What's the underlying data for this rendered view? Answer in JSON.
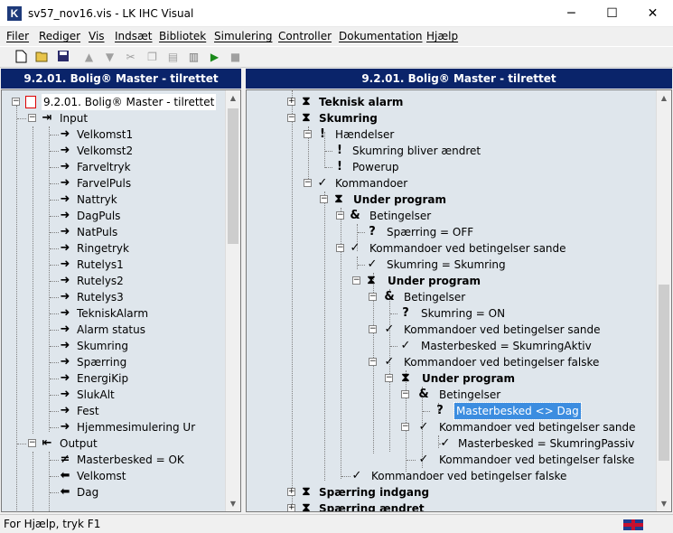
{
  "window": {
    "title": "sv57_nov16.vis - LK IHC Visual",
    "icon_letter": "K",
    "minimize": "─",
    "maximize": "☐",
    "close": "✕"
  },
  "menu": [
    "Filer",
    "Rediger",
    "Vis",
    "Indsæt",
    "Bibliotek",
    "Simulering",
    "Controller",
    "Dokumentation",
    "Hjælp"
  ],
  "toolbar": [
    "new-file-icon",
    "open-folder-icon",
    "save-icon",
    "upload-icon",
    "download-icon",
    "cut-icon",
    "copy-icon",
    "paste-icon",
    "run-icon",
    "stop-icon"
  ],
  "left_panel": {
    "title": "9.2.01. Bolig® Master - tilrettet",
    "root": "9.2.01. Bolig® Master - tilrettet",
    "input_label": "Input",
    "inputs": [
      "Velkomst1",
      "Velkomst2",
      "Farveltryk",
      "FarvelPuls",
      "Nattryk",
      "DagPuls",
      "NatPuls",
      "Ringetryk",
      "Rutelys1",
      "Rutelys2",
      "Rutelys3",
      "TekniskAlarm",
      "Alarm status",
      "Skumring",
      "Spærring",
      "EnergiKip",
      "SlukAlt",
      "Fest",
      "Hjemmesimulering Ur"
    ],
    "output_label": "Output",
    "outputs": [
      "Masterbesked = OK",
      "Velkomst",
      "Dag"
    ]
  },
  "right_panel": {
    "title": "9.2.01. Bolig® Master - tilrettet",
    "rows": [
      "Teknisk alarm",
      "Skumring",
      "Hændelser",
      "Skumring bliver ændret",
      "Powerup",
      "Kommandoer",
      "Under program",
      "Betingelser",
      "Spærring = OFF",
      "Kommandoer ved betingelser sande",
      "Skumring = Skumring",
      "Under program",
      "Betingelser",
      "Skumring = ON",
      "Kommandoer ved betingelser sande",
      "Masterbesked = SkumringAktiv",
      "Kommandoer ved betingelser falske",
      "Under program",
      "Betingelser",
      "Masterbesked <> Dag",
      "Kommandoer ved betingelser sande",
      "Masterbesked = SkumringPassiv",
      "Kommandoer ved betingelser falske",
      "Kommandoer ved betingelser falske",
      "Spærring indgang",
      "Spærring ændret"
    ]
  },
  "status": {
    "text": "For Hjælp, tryk F1"
  }
}
